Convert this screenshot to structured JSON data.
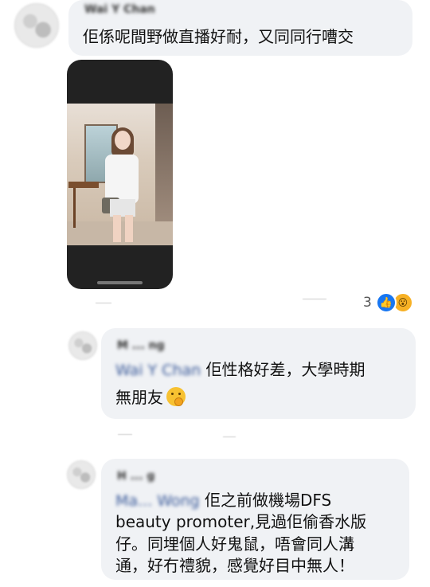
{
  "comments": [
    {
      "author": "Wai Y Chan",
      "text": "佢係呢間野做直播好耐，又同同行嘈交"
    },
    {
      "author": "M ... ng",
      "mention": "Wai Y Chan",
      "text_line1": "佢性格好差，大學時期",
      "text_line2": "無朋友"
    },
    {
      "author": "H ... g",
      "mention": "Ma... Wong",
      "text_line1": "佢之前做機場DFS",
      "text_line2": "beauty promoter,見過佢偷香水版",
      "text_line3": "仔。同埋個人好鬼鼠，唔會同人溝",
      "text_line4": "通，好冇禮貌，感覺好目中無人！"
    }
  ],
  "reactions": {
    "count": "3",
    "icons": [
      "like-icon",
      "wow-icon"
    ],
    "colors": {
      "like": "#1877f2",
      "wow": "#f7b125"
    }
  },
  "colors": {
    "bubble": "#f0f2f5",
    "mention": "#385898",
    "text": "#111111"
  }
}
